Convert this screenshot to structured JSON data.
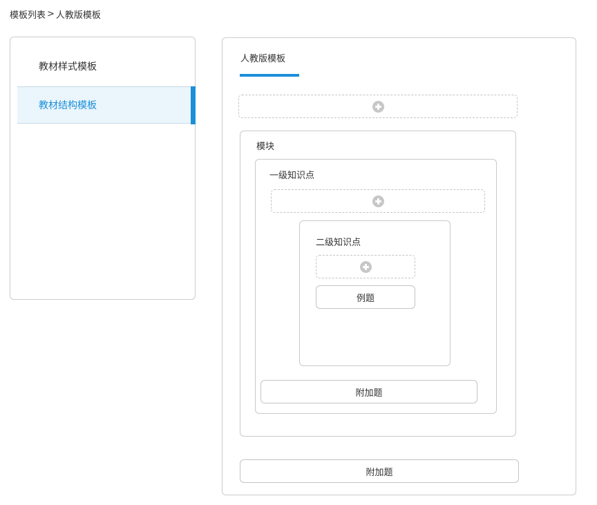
{
  "breadcrumb": {
    "parent": "模板列表",
    "separator": ">",
    "current": "人教版模板"
  },
  "sidebar": {
    "items": [
      {
        "label": "教材样式模板",
        "active": false
      },
      {
        "label": "教材结构模板",
        "active": true
      }
    ]
  },
  "main": {
    "title": "人教版模板",
    "module": {
      "label": "模块",
      "level1": {
        "label": "一级知识点",
        "level2": {
          "label": "二级知识点",
          "example_button": "例题"
        },
        "extra_button": "附加题"
      }
    },
    "extra_button": "附加题"
  },
  "colors": {
    "accent": "#1b8fd9",
    "active_bg": "#eaf5fc",
    "border": "#cccccc",
    "plus_icon": "#c7c7c7"
  },
  "icons": {
    "add": "plus-circle-icon"
  }
}
